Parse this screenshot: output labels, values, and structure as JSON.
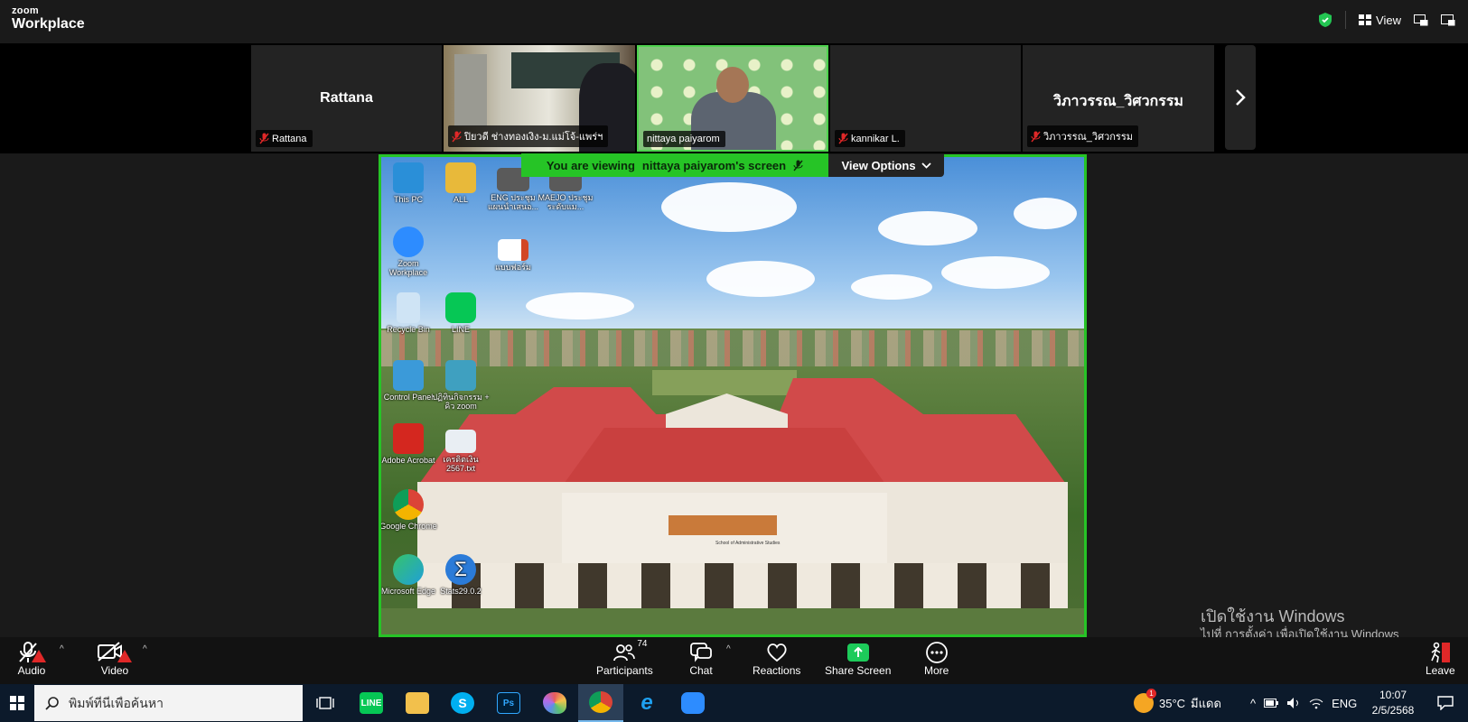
{
  "app": {
    "brand_small": "zoom",
    "brand_large": "Workplace"
  },
  "titlebar": {
    "view_label": "View"
  },
  "gallery": {
    "tiles": [
      {
        "name": "Rattana",
        "display_name": "Rattana",
        "muted": true,
        "video": false
      },
      {
        "name": "ปิยวดี ช่างทองเงิง-ม.แม่โจ้-แพร่ฯ",
        "muted": true,
        "video": true
      },
      {
        "name": "nittaya paiyarom",
        "muted": false,
        "video": true,
        "active": true
      },
      {
        "name": "kannikar L.",
        "muted": true,
        "video": false
      },
      {
        "name": "วิภาวรรณ_วิศวกรรม",
        "display_name": "วิภาวรรณ_วิศวกรรม",
        "muted": true,
        "video": false
      }
    ]
  },
  "share": {
    "banner_prefix": "You are viewing",
    "banner_name": "nittaya paiyarom's screen",
    "view_options": "View Options",
    "desktop_icons": [
      {
        "label": "This PC",
        "color": "#2a8fd8"
      },
      {
        "label": "ALL",
        "color": "#e8b93a"
      },
      {
        "label": "ENG ประชุม แผนนำเสนอ...",
        "color": "#5a5a5a"
      },
      {
        "label": "MAEJO ประชุม ระดับแม...",
        "color": "#5a5a5a"
      },
      {
        "label": "Zoom Workplace",
        "color": "#2d8cff"
      },
      {
        "label": "แบบฟอร์ม",
        "color": "#d24726"
      },
      {
        "label": "Recycle Bin",
        "color": "#cfe4f5"
      },
      {
        "label": "LINE",
        "color": "#06c755"
      },
      {
        "label": "Control Panel",
        "color": "#3b9ad9"
      },
      {
        "label": "ปฏิทินกิจกรรม + คิว zoom",
        "color": "#3fa0c0"
      },
      {
        "label": "Adobe Acrobat",
        "color": "#d4271f"
      },
      {
        "label": "เครดิตเงิน 2567.txt",
        "color": "#e9eef3"
      },
      {
        "label": "Google Chrome",
        "color": "#e9a13b"
      },
      {
        "label": "Microsoft Edge",
        "color": "#1f9fd9"
      },
      {
        "label": "Stats29.0.2",
        "color": "#2b7bd8"
      }
    ],
    "building_sign": "School of Administrative Studies"
  },
  "watermark": {
    "line1": "เปิดใช้งาน Windows",
    "line2": "ไปที่ การตั้งค่า เพื่อเปิดใช้งาน Windows"
  },
  "toolbar": {
    "audio": "Audio",
    "video": "Video",
    "participants": "Participants",
    "participant_count": "74",
    "chat": "Chat",
    "reactions": "Reactions",
    "share_screen": "Share Screen",
    "more": "More",
    "leave": "Leave"
  },
  "taskbar": {
    "search_placeholder": "พิมพ์ที่นี่เพื่อค้นหา",
    "apps": [
      {
        "name": "task-view",
        "color": "#0c1a2b"
      },
      {
        "name": "LINE",
        "color": "#06c755"
      },
      {
        "name": "File Explorer",
        "color": "#f2c04c"
      },
      {
        "name": "Skype",
        "color": "#00aff0"
      },
      {
        "name": "Photoshop",
        "color": "#001e36"
      },
      {
        "name": "Paint",
        "color": "#8a6bd1"
      },
      {
        "name": "Chrome",
        "color": "#e9a13b"
      },
      {
        "name": "Internet Explorer",
        "color": "#1ea1f1"
      },
      {
        "name": "Zoom",
        "color": "#2d8cff"
      }
    ],
    "weather_temp": "35°C",
    "weather_desc": "มีแดด",
    "weather_badge": "1",
    "language": "ENG",
    "time": "10:07",
    "date": "2/5/2568"
  },
  "colors": {
    "active_border": "#26c426",
    "toolbar_bg": "#121212",
    "taskbar_bg": "#0c1a2b"
  }
}
